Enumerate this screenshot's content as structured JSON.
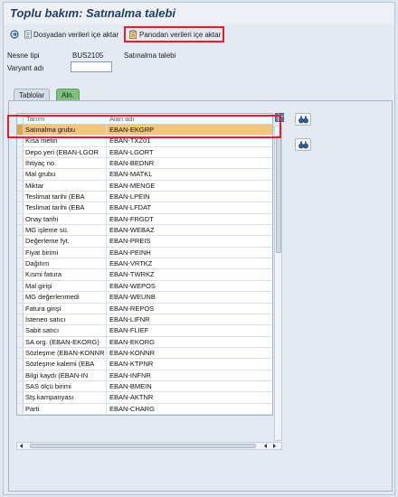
{
  "title": "Toplu bakım: Satınalma talebi",
  "toolbar": {
    "import_file_label": "Dosyadan verileri içe aktar",
    "import_clipboard_label": "Panodan verileri içe aktar"
  },
  "fields": {
    "object_type_label": "Nesne tipi",
    "object_type_value": "BUS2105",
    "object_type_desc": "Satınalma talebi",
    "variant_label": "Varyant adı",
    "variant_value": ""
  },
  "tabs": [
    {
      "label": "Tablolar"
    },
    {
      "label": "Aln."
    }
  ],
  "table": {
    "columns": [
      "Tanım",
      "Alan adı"
    ],
    "rows": [
      {
        "desc": "Satınalma grubu",
        "field": "EBAN-EKGRP",
        "selected": true
      },
      {
        "desc": "Kısa metin",
        "field": "EBAN-TXZ01"
      },
      {
        "desc": "Depo yeri (EBAN-LGOR",
        "field": "EBAN-LGORT"
      },
      {
        "desc": "İhtiyaç no.",
        "field": "EBAN-BEDNR"
      },
      {
        "desc": "Mal grubu",
        "field": "EBAN-MATKL"
      },
      {
        "desc": "Miktar",
        "field": "EBAN-MENGE"
      },
      {
        "desc": "Teslimat tarihi (EBA",
        "field": "EBAN-LPEIN"
      },
      {
        "desc": "Teslimat tarihi (EBA",
        "field": "EBAN-LFDAT"
      },
      {
        "desc": "Onay tarihi",
        "field": "EBAN-FRGDT"
      },
      {
        "desc": "MG işleme sü.",
        "field": "EBAN-WEBAZ"
      },
      {
        "desc": "Değerleme fyt.",
        "field": "EBAN-PREIS"
      },
      {
        "desc": "Fiyat birimi",
        "field": "EBAN-PEINH"
      },
      {
        "desc": "Dağıtım",
        "field": "EBAN-VRTKZ"
      },
      {
        "desc": "Kısmi fatura",
        "field": "EBAN-TWRKZ"
      },
      {
        "desc": "Mal girişi",
        "field": "EBAN-WEPOS"
      },
      {
        "desc": "MG değerlenmedi",
        "field": "EBAN-WEUNB"
      },
      {
        "desc": "Fatura girişi",
        "field": "EBAN-REPOS"
      },
      {
        "desc": "İstenen satıcı",
        "field": "EBAN-LIFNR"
      },
      {
        "desc": "Sabit satıcı",
        "field": "EBAN-FLIEF"
      },
      {
        "desc": "SA org. (EBAN-EKORG)",
        "field": "EBAN-EKORG"
      },
      {
        "desc": "Sözleşme (EBAN-KONNR",
        "field": "EBAN-KONNR"
      },
      {
        "desc": "Sözleşme kalemi (EBA",
        "field": "EBAN-KTPNR"
      },
      {
        "desc": "Bilgi kaydı (EBAN-IN",
        "field": "EBAN-INFNR"
      },
      {
        "desc": "SAS ölçü birimi",
        "field": "EBAN-BMEIN"
      },
      {
        "desc": "Stş.kampanyası",
        "field": "EBAN-AKTNR"
      },
      {
        "desc": "Parti",
        "field": "EBAN-CHARG"
      }
    ]
  },
  "colors": {
    "title": "#1f3e64",
    "selected_row": "#f6c37c",
    "highlight_box": "#e0202a",
    "active_tab": "#7fbf7f"
  },
  "icons": [
    "import-file-icon",
    "clipboard-icon",
    "binoculars-icon",
    "binoculars-next-icon",
    "table-settings-icon"
  ]
}
